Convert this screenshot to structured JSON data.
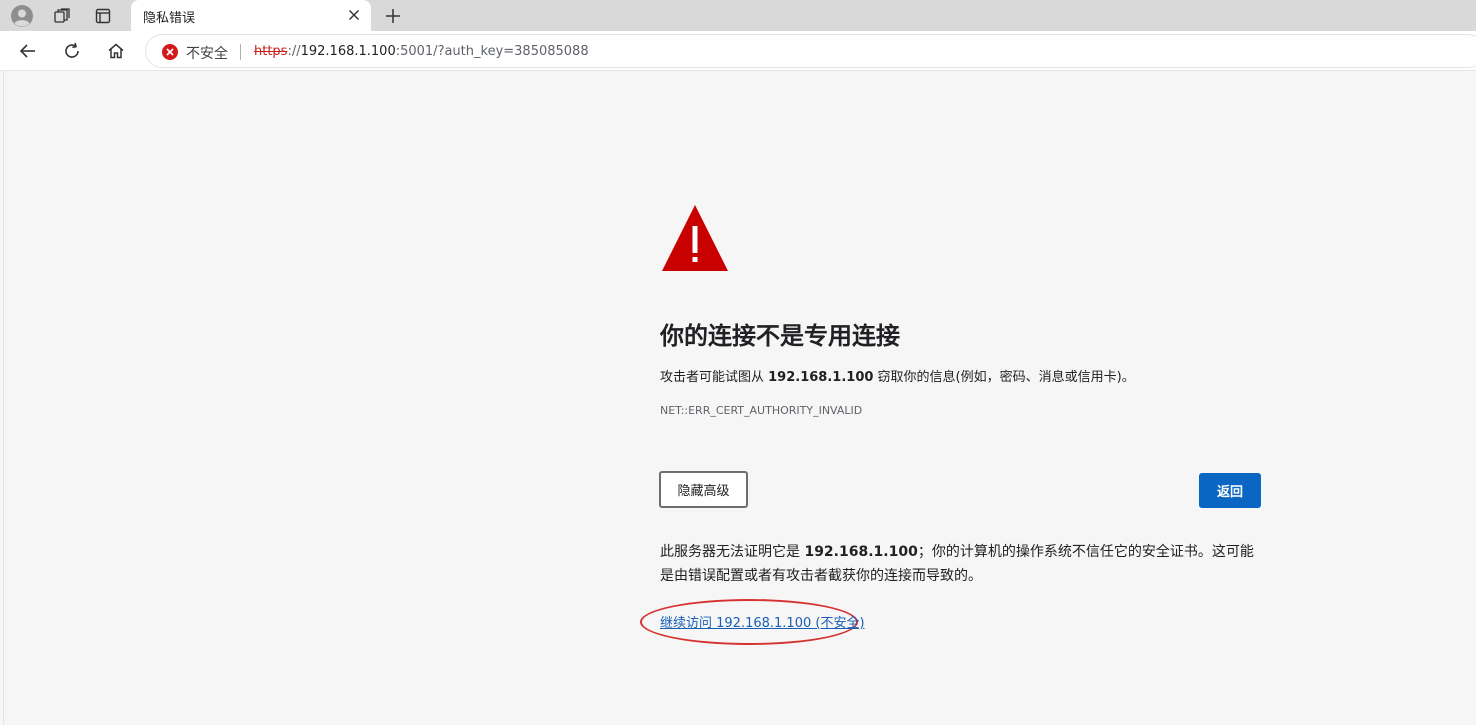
{
  "tab": {
    "title": "隐私错误"
  },
  "toolbar": {
    "security_label": "不安全",
    "url_scheme": "https",
    "url_rest_prefix": "://",
    "url_host": "192.168.1.100",
    "url_tail": ":5001/?auth_key=385085088"
  },
  "page": {
    "heading": "你的连接不是专用连接",
    "desc_prefix": "攻击者可能试图从 ",
    "desc_host": "192.168.1.100",
    "desc_suffix": " 窃取你的信息(例如，密码、消息或信用卡)。",
    "error_code": "NET::ERR_CERT_AUTHORITY_INVALID",
    "hide_advanced_label": "隐藏高级",
    "back_label": "返回",
    "detail_prefix": "此服务器无法证明它是 ",
    "detail_host": "192.168.1.100",
    "detail_suffix": "；你的计算机的操作系统不信任它的安全证书。这可能是由错误配置或者有攻击者截获你的连接而导致的。",
    "proceed_link": "继续访问 192.168.1.100 (不安全)"
  },
  "colors": {
    "accent_blue": "#0a66c2",
    "warning_red": "#c90000",
    "annotation_red": "#d6322f",
    "link_blue": "#1a5fb4"
  },
  "icons": [
    "profile-icon",
    "collections-icon",
    "tab-actions-icon",
    "close-icon",
    "new-tab-icon",
    "back-icon",
    "refresh-icon",
    "home-icon",
    "not-secure-icon",
    "warning-triangle-icon"
  ]
}
